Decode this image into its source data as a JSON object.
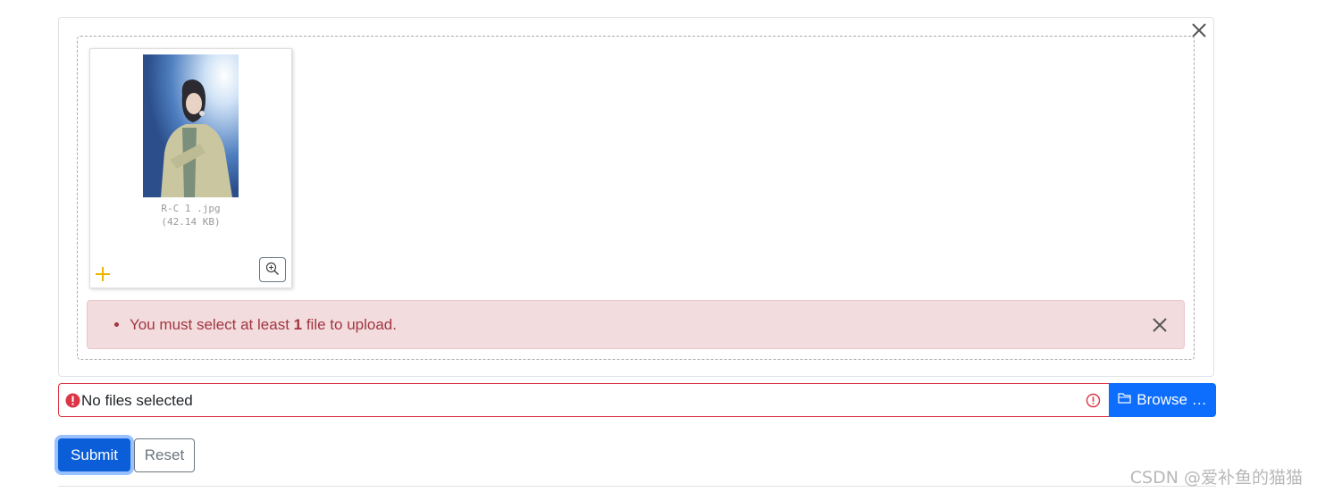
{
  "preview": {
    "file_name": "R-C 1 .jpg",
    "file_size": "(42.14 KB)"
  },
  "alert": {
    "message_prefix": "You must select at least ",
    "message_count": "1",
    "message_suffix": " file to upload."
  },
  "file_input": {
    "caption": "No files selected",
    "browse_label": "Browse …"
  },
  "buttons": {
    "submit": "Submit",
    "reset": "Reset"
  },
  "watermark": "CSDN @爱补鱼的猫猫",
  "colors": {
    "primary": "#0d6efd",
    "danger": "#dc3545",
    "alert_bg": "#f2dcde",
    "alert_text": "#a33540",
    "drag_handle": "#f0b400"
  },
  "icons": {
    "panel_close": "close-icon",
    "drag": "plus-move-icon",
    "zoom": "zoom-in-icon",
    "alert_close": "close-icon",
    "caption_error": "exclamation-circle-icon",
    "caption_warning": "exclamation-circle-outline-icon",
    "browse": "folder-open-icon"
  }
}
